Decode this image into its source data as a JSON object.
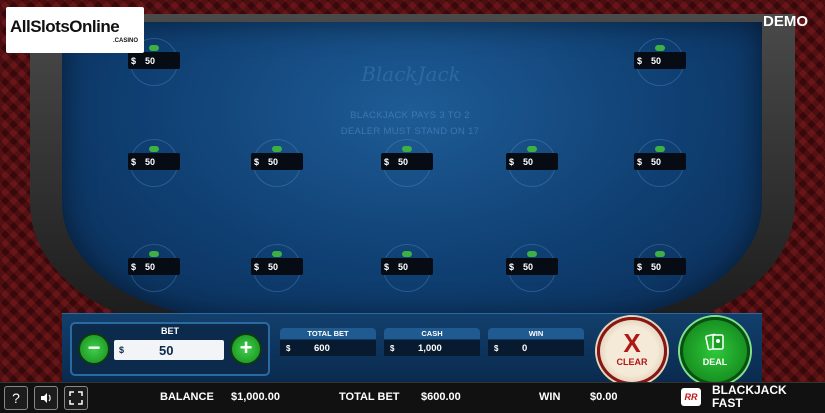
{
  "logo": {
    "main": "AllSlotsOnline",
    "sub": ".CASINO"
  },
  "mode_label": "DEMO",
  "felt": {
    "logo_text": "BlackJack",
    "rule1": "BLACKJACK PAYS 3 TO 2",
    "rule2": "DEALER MUST STAND ON 17"
  },
  "spots": [
    {
      "currency": "$",
      "amount": "50"
    },
    {
      "currency": "$",
      "amount": "50"
    },
    {
      "currency": "$",
      "amount": "50"
    },
    {
      "currency": "$",
      "amount": "50"
    },
    {
      "currency": "$",
      "amount": "50"
    },
    {
      "currency": "$",
      "amount": "50"
    },
    {
      "currency": "$",
      "amount": "50"
    },
    {
      "currency": "$",
      "amount": "50"
    },
    {
      "currency": "$",
      "amount": "50"
    },
    {
      "currency": "$",
      "amount": "50"
    },
    {
      "currency": "$",
      "amount": "50"
    },
    {
      "currency": "$",
      "amount": "50"
    }
  ],
  "bet": {
    "label": "BET",
    "currency": "$",
    "value": "50",
    "minus": "−",
    "plus": "+"
  },
  "stats": {
    "total_bet": {
      "label": "TOTAL BET",
      "currency": "$",
      "value": "600"
    },
    "cash": {
      "label": "CASH",
      "currency": "$",
      "value": "1,000"
    },
    "win": {
      "label": "WIN",
      "currency": "$",
      "value": "0"
    }
  },
  "buttons": {
    "clear_symbol": "X",
    "clear_label": "CLEAR",
    "deal_label": "DEAL"
  },
  "bottom_bar": {
    "help": "?",
    "balance_label": "BALANCE",
    "balance_value": "$1,000.00",
    "total_bet_label": "TOTAL BET",
    "total_bet_value": "$600.00",
    "win_label": "WIN",
    "win_value": "$0.00",
    "brand_icon": "RR",
    "game_title_line1": "BLACKJACK",
    "game_title_line2": "FAST"
  },
  "colors": {
    "felt": "#0f3f72",
    "accent_green": "#3fd04a",
    "clear_red": "#b01818"
  }
}
